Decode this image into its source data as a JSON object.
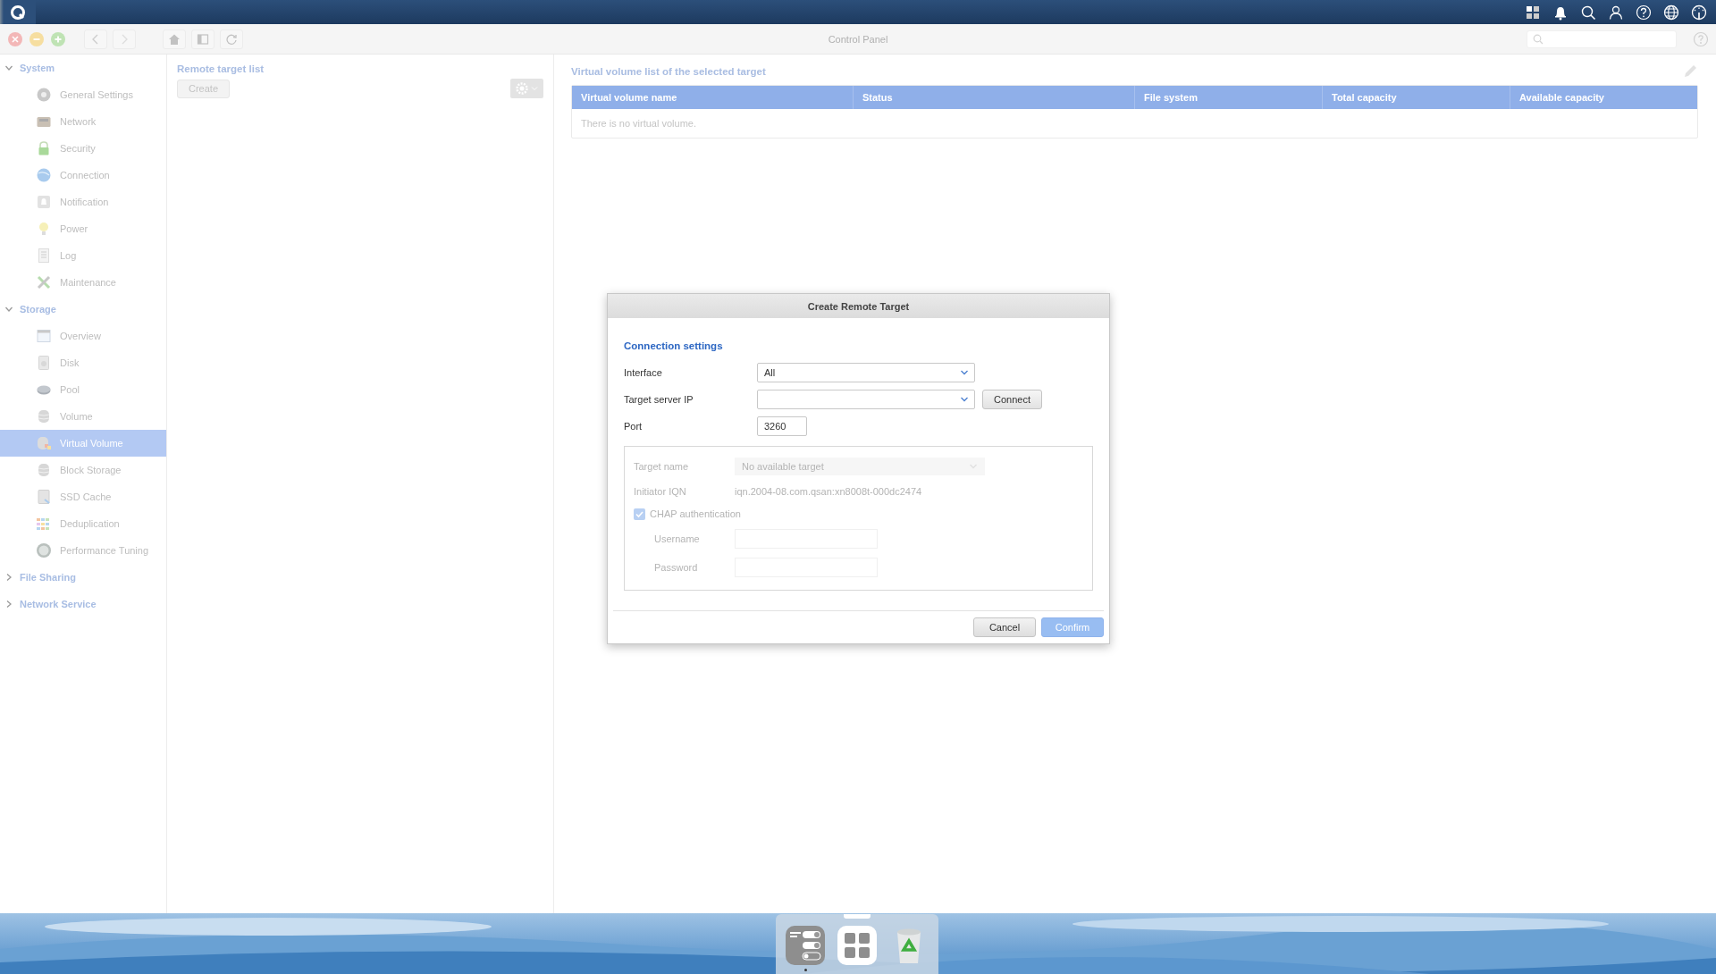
{
  "window": {
    "title": "Control Panel"
  },
  "sidebar": {
    "groups": [
      {
        "label": "System",
        "expanded": true,
        "items": [
          {
            "label": "General Settings",
            "selected": false
          },
          {
            "label": "Network",
            "selected": false
          },
          {
            "label": "Security",
            "selected": false
          },
          {
            "label": "Connection",
            "selected": false
          },
          {
            "label": "Notification",
            "selected": false
          },
          {
            "label": "Power",
            "selected": false
          },
          {
            "label": "Log",
            "selected": false
          },
          {
            "label": "Maintenance",
            "selected": false
          }
        ]
      },
      {
        "label": "Storage",
        "expanded": true,
        "items": [
          {
            "label": "Overview",
            "selected": false
          },
          {
            "label": "Disk",
            "selected": false
          },
          {
            "label": "Pool",
            "selected": false
          },
          {
            "label": "Volume",
            "selected": false
          },
          {
            "label": "Virtual Volume",
            "selected": true
          },
          {
            "label": "Block Storage",
            "selected": false
          },
          {
            "label": "SSD Cache",
            "selected": false
          },
          {
            "label": "Deduplication",
            "selected": false
          },
          {
            "label": "Performance Tuning",
            "selected": false
          }
        ]
      },
      {
        "label": "File Sharing",
        "expanded": false
      },
      {
        "label": "Network Service",
        "expanded": false
      }
    ]
  },
  "remote_targets": {
    "title": "Remote target list",
    "create_button": "Create"
  },
  "virtual_volumes": {
    "title": "Virtual volume list of the selected target",
    "columns": [
      "Virtual volume name",
      "Status",
      "File system",
      "Total capacity",
      "Available capacity"
    ],
    "empty_message": "There is no virtual volume."
  },
  "dialog": {
    "title": "Create Remote Target",
    "section": "Connection settings",
    "fields": [
      {
        "kind": "select",
        "label": "Interface",
        "value": "All"
      },
      {
        "kind": "select",
        "label": "Target server IP",
        "button": "Connect"
      },
      {
        "kind": "input",
        "label": "Port",
        "value": "3260"
      }
    ],
    "target": {
      "disabled": true,
      "target_name": {
        "label": "Target name",
        "value": "No available target"
      },
      "initiator_iqn": {
        "label": "Initiator IQN",
        "value": "iqn.2004-08.com.qsan:xn8008t-000dc2474"
      },
      "chap": {
        "label": "CHAP authentication",
        "checked": true
      },
      "credentials": [
        {
          "label": "Username"
        },
        {
          "label": "Password"
        }
      ]
    },
    "buttons": [
      {
        "label": "Cancel",
        "kind": "secondary"
      },
      {
        "label": "Confirm",
        "kind": "primary"
      }
    ]
  },
  "dock": [
    {
      "running": true
    },
    {
      "running": false
    },
    {
      "running": false
    }
  ]
}
